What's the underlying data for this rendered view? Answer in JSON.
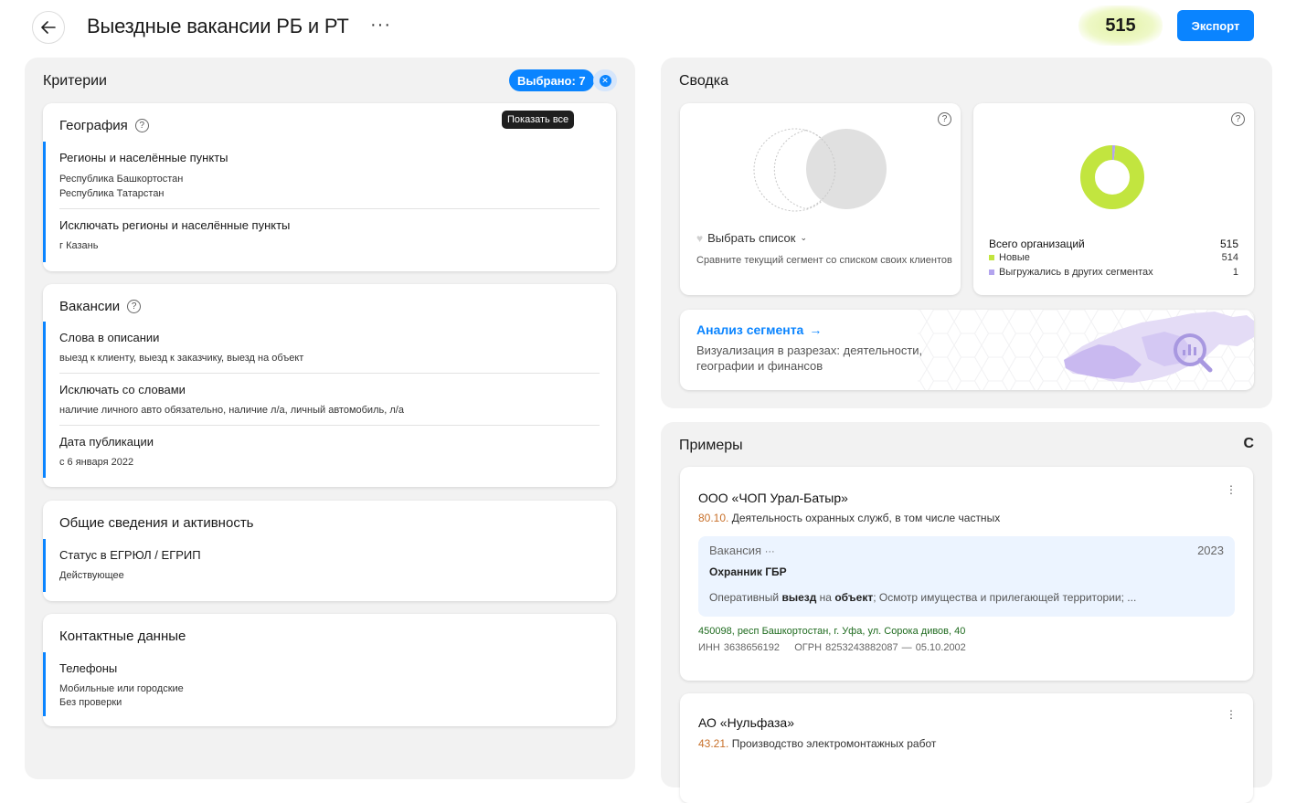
{
  "header": {
    "title": "Выездные вакансии РБ и РТ",
    "more": "···",
    "count": "515",
    "export_label": "Экспорт"
  },
  "criteria": {
    "title": "Критерии",
    "selected_label": "Выбрано: 7",
    "tooltip": "Показать все",
    "geography": {
      "title": "География",
      "items": [
        {
          "name": "Регионы и населённые пункты",
          "values": [
            "Республика Башкортостан",
            "Республика Татарстан"
          ]
        },
        {
          "name": "Исключать регионы и населённые пункты",
          "values": [
            "г Казань"
          ]
        }
      ]
    },
    "vacancies": {
      "title": "Вакансии",
      "items": [
        {
          "name": "Слова в описании",
          "values": [
            "выезд к клиенту, выезд к заказчику, выезд на объект"
          ]
        },
        {
          "name": "Исключать со словами",
          "values": [
            "наличие личного авто обязательно, наличие л/а, личный автомобиль, л/а"
          ]
        },
        {
          "name": "Дата публикации",
          "values": [
            "с 6 января 2022"
          ]
        }
      ]
    },
    "general": {
      "title": "Общие сведения и активность",
      "items": [
        {
          "name": "Статус в ЕГРЮЛ / ЕГРИП",
          "values": [
            "Действующее"
          ]
        }
      ]
    },
    "contacts": {
      "title": "Контактные данные",
      "items": [
        {
          "name": "Телефоны",
          "values": [
            "Мобильные или городские",
            "Без проверки"
          ]
        }
      ]
    }
  },
  "summary": {
    "title": "Сводка",
    "compare": {
      "choose_label": "Выбрать список",
      "hint": "Сравните текущий сегмент со списком своих клиентов"
    },
    "orgs": {
      "total_label": "Всего организаций",
      "total": "515",
      "new_label": "Новые",
      "new": "514",
      "exported_label": "Выгружались в других сегментах",
      "exported": "1",
      "new_color": "#c2e53f",
      "exported_color": "#b3a4ee"
    },
    "analysis": {
      "title": "Анализ сегмента",
      "arrow": "→",
      "desc": "Визуализация в разрезах: деятельности, географии и финансов"
    }
  },
  "examples": {
    "title": "Примеры",
    "refresh": "C",
    "items": [
      {
        "name": "ООО «ЧОП Урал-Батыр»",
        "okved_code": "80.10.",
        "okved_name": " Деятельность охранных служб, в том числе частных",
        "vacancy": {
          "label": "Вакансия",
          "more": "···",
          "year": "2023",
          "title": "Охранник ГБР",
          "s1": "Оперативный ",
          "s2": "выезд",
          "s3": " на ",
          "s4": "объект",
          "s5": "; Осмотр имущества и прилегающей территории; ..."
        },
        "address": "450098, респ Башкортостан, г. Уфа, ул. Сорока дивов, 40",
        "ids": "ИНН 3638656192    ОГРН 8253243882087 — 05.10.2002"
      },
      {
        "name": "АО «Нульфаза»",
        "okved_code": "43.21.",
        "okved_name": " Производство электромонтажных работ"
      }
    ]
  }
}
